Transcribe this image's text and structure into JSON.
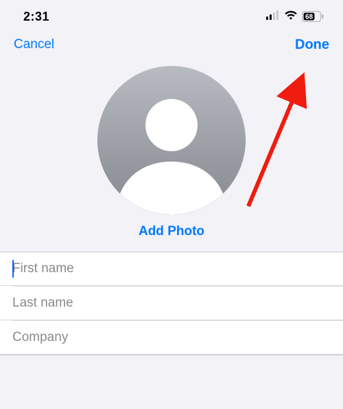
{
  "status": {
    "time": "2:31",
    "battery_percent": "68"
  },
  "nav": {
    "cancel": "Cancel",
    "done": "Done"
  },
  "photo": {
    "add_label": "Add Photo"
  },
  "fields": {
    "first_name": {
      "value": "",
      "placeholder": "First name"
    },
    "last_name": {
      "value": "",
      "placeholder": "Last name"
    },
    "company": {
      "value": "",
      "placeholder": "Company"
    }
  },
  "annotation": {
    "arrow_target": "done"
  }
}
